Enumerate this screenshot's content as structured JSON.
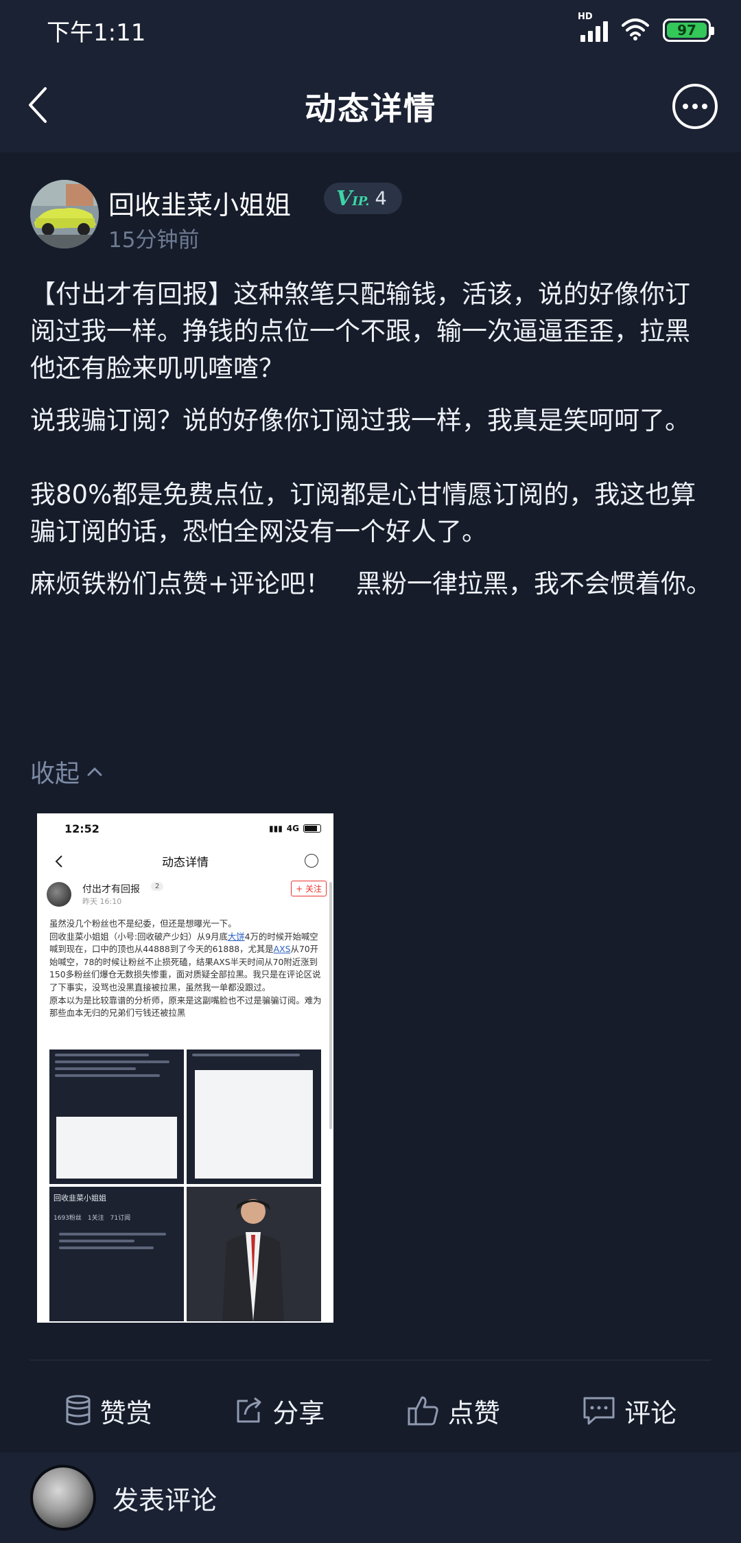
{
  "status_bar": {
    "time": "下午1:11",
    "network": "HD",
    "battery": "97",
    "battery_color": "#34c759"
  },
  "nav": {
    "title": "动态详情",
    "back_icon": "chevron-left-icon",
    "more_icon": "more-dots-icon"
  },
  "post": {
    "author": "回收韭菜小姐姐",
    "vip_level": "4",
    "time": "15分钟前",
    "paragraphs": [
      "【付出才有回报】这种煞笔只配输钱，活该，说的好像你订阅过我一样。挣钱的点位一个不跟，输一次逼逼歪歪，拉黑他还有脸来叽叽喳喳？",
      "说我骗订阅？说的好像你订阅过我一样，我真是笑呵呵了。",
      "我80%都是免费点位，订阅都是心甘情愿订阅的，我这也算骗订阅的话，恐怕全网没有一个好人了。",
      "麻烦铁粉们点赞+评论吧！　黑粉一律拉黑，我不会惯着你。"
    ],
    "collapse_label": "收起",
    "accent_color": "#3dd6a6"
  },
  "embedded_screenshot": {
    "time": "12:52",
    "network": "4G",
    "title": "动态详情",
    "author": "付出才有回报",
    "vip": "2",
    "post_time": "昨天 16:10",
    "follow_label": "+ 关注",
    "text_parts": [
      "虽然没几个粉丝也不是纪委，但还是想曝光一下。",
      "回收韭菜小姐姐（小号:回收破产少妇）从9月底",
      "大饼",
      "4万的时候开始喊空喊到现在，口中的顶也从44888到了今天的61888，尤其是",
      "AXS",
      "从70开始喊空，78的时候让粉丝不止损死磕，结果AXS半天时间从70附近涨到150多粉丝们爆仓无数损失惨重，面对质疑全部拉黑。我只是在评论区说了下事实，没骂也没黑直接被拉黑，虽然我一单都没跟过。",
      "原本以为是比较靠谱的分析师，原来是这副嘴脸也不过是骗骗订阅。难为那些血本无归的兄弟们亏钱还被拉黑"
    ],
    "grid_profile_name": "回收韭菜小姐姐",
    "grid_profile_stats": "1693粉丝　1关注　71订阅"
  },
  "actions": [
    {
      "label": "赞赏",
      "icon": "coin-stack-icon"
    },
    {
      "label": "分享",
      "icon": "share-icon"
    },
    {
      "label": "点赞",
      "icon": "thumbs-up-icon"
    },
    {
      "label": "评论",
      "icon": "comment-icon"
    }
  ],
  "comment_bar": {
    "placeholder": "发表评论"
  }
}
